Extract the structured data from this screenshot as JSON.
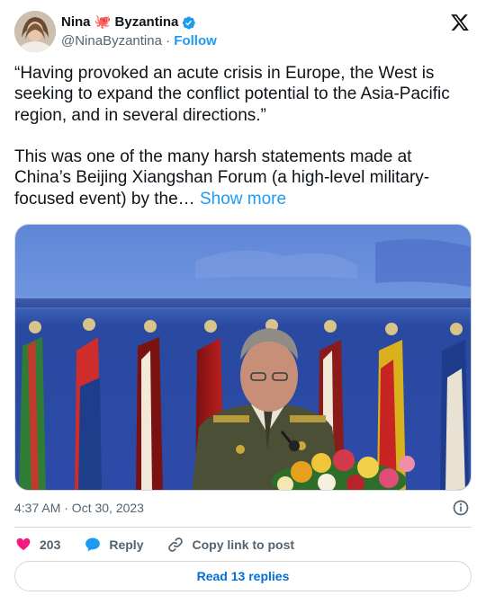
{
  "author": {
    "display_name": "Nina 🐙 Byzantina",
    "handle": "@NinaByzantina",
    "separator": " · ",
    "follow_label": "Follow",
    "verified": true
  },
  "tweet": {
    "text": "“Having provoked an acute crisis in Europe, the West is seeking to expand the conflict potential to the Asia-Pacific region, and in several directions.”\n\nThis was one of the many harsh statements made at China’s Beijing Xiangshan Forum (a high-level military-focused event) by the… ",
    "show_more_label": "Show more",
    "timestamp": "4:37 AM · Oct 30, 2023"
  },
  "actions": {
    "like_count": "203",
    "reply_label": "Reply",
    "copy_link_label": "Copy link to post"
  },
  "footer": {
    "read_replies_label": "Read 13 replies"
  },
  "colors": {
    "accent": "#1d9bf0",
    "like": "#f91880",
    "verified": "#1d9bf0",
    "text_secondary": "#536471"
  },
  "icons": [
    "avatar",
    "octopus-emoji",
    "verified-badge-icon",
    "x-logo-icon",
    "info-icon",
    "heart-icon",
    "reply-bubble-icon",
    "link-icon"
  ]
}
